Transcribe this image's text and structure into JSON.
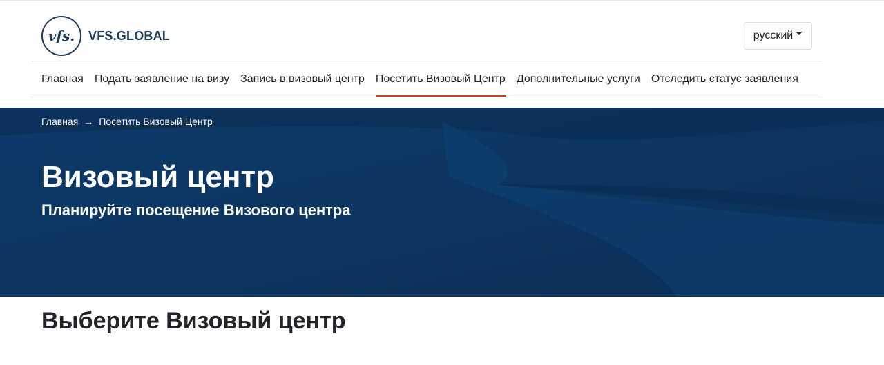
{
  "brand": {
    "logo_mark": "vfs.",
    "name": "VFS.GLOBAL"
  },
  "language": {
    "selected": "русский"
  },
  "nav": {
    "items": [
      {
        "label": "Главная"
      },
      {
        "label": "Подать заявление на визу"
      },
      {
        "label": "Запись в визовый центр"
      },
      {
        "label": "Посетить Визовый Центр",
        "active": true
      },
      {
        "label": "Дополнительные услуги"
      },
      {
        "label": "Отследить статус заявления"
      }
    ]
  },
  "breadcrumb": {
    "home": "Главная",
    "current": "Посетить Визовый Центр"
  },
  "hero": {
    "title": "Визовый центр",
    "subtitle": "Планируйте посещение Визового центра"
  },
  "section": {
    "title": "Выберите Визовый центр"
  },
  "colors": {
    "hero_bg": "#0b3560",
    "accent": "#c8451b",
    "brand": "#1c3a5e"
  }
}
